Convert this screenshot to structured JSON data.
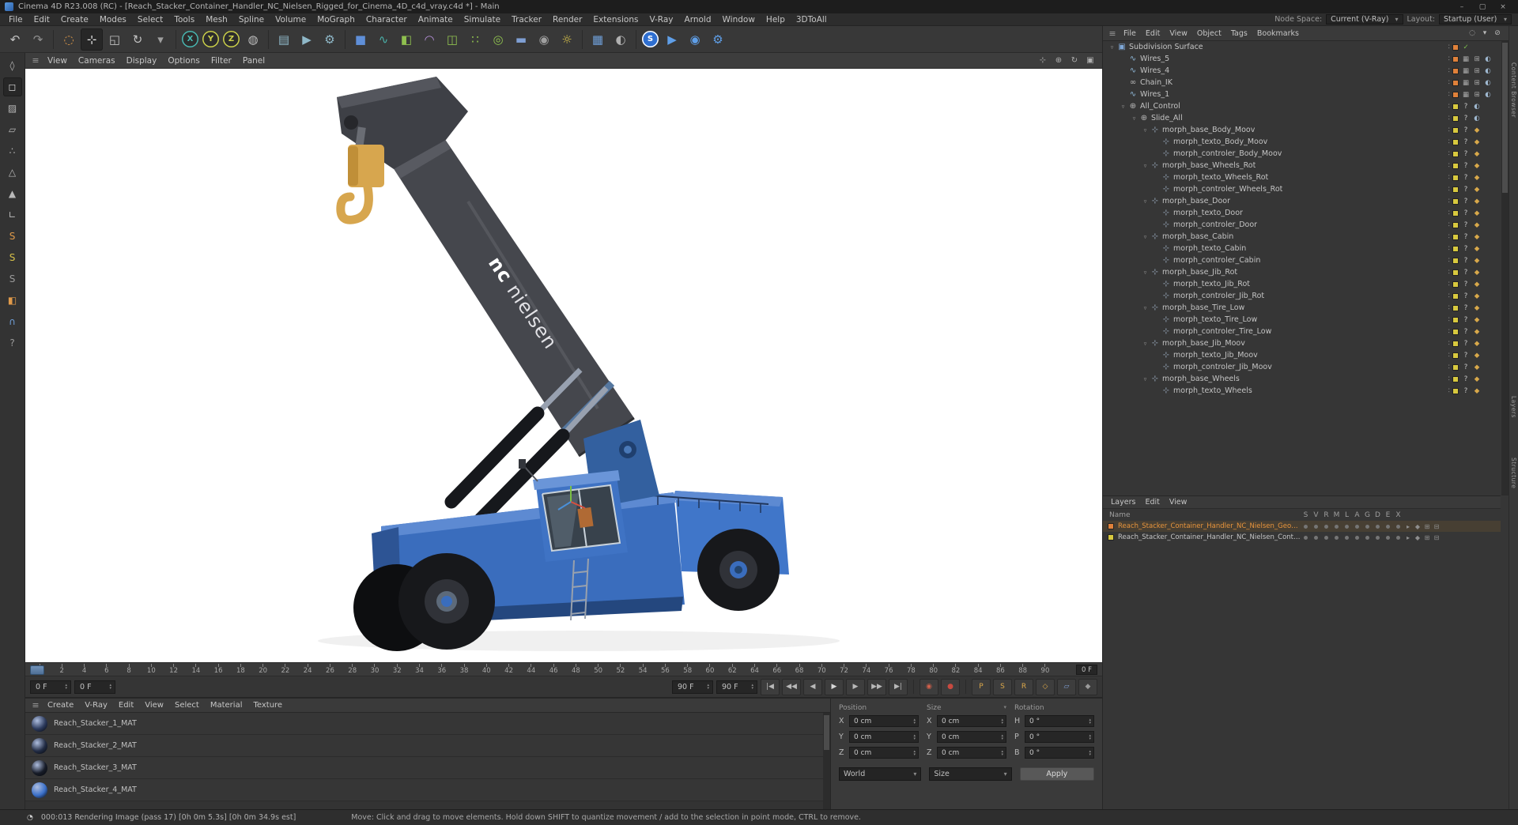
{
  "icons": {
    "hamburger": "≡"
  },
  "window": {
    "title": "Cinema 4D R23.008 (RC) - [Reach_Stacker_Container_Handler_NC_Nielsen_Rigged_for_Cinema_4D_c4d_vray.c4d *] - Main",
    "controls": {
      "minimize": "–",
      "maximize": "▢",
      "close": "×"
    }
  },
  "menu_bar": {
    "items": [
      "File",
      "Edit",
      "Create",
      "Modes",
      "Select",
      "Tools",
      "Mesh",
      "Spline",
      "Volume",
      "MoGraph",
      "Character",
      "Animate",
      "Simulate",
      "Tracker",
      "Render",
      "Extensions",
      "V-Ray",
      "Arnold",
      "Window",
      "Help",
      "3DToAll"
    ],
    "node_space": {
      "label": "Node Space:",
      "value": "Current (V-Ray)"
    },
    "layout": {
      "label": "Layout:",
      "value": "Startup (User)"
    }
  },
  "toolbar": {
    "icons": [
      {
        "name": "undo-icon",
        "glyph": "↶",
        "fg": "#c2c2c2"
      },
      {
        "name": "redo-icon",
        "glyph": "↷",
        "fg": "#8f8f8f"
      },
      {
        "divider": true
      },
      {
        "name": "live-selection-icon",
        "glyph": "◌",
        "fg": "#e09a4a"
      },
      {
        "name": "move-tool-icon",
        "glyph": "⊹",
        "fg": "#ececec",
        "active": true
      },
      {
        "name": "scale-tool-icon",
        "glyph": "◱",
        "fg": "#c2c2c2"
      },
      {
        "name": "rotate-tool-icon",
        "glyph": "↻",
        "fg": "#c2c2c2"
      },
      {
        "name": "last-used-tool-icon",
        "glyph": "▾",
        "fg": "#9f9f9f"
      },
      {
        "divider": true
      },
      {
        "name": "x-axis-lock-button",
        "glyph": "X",
        "fg": "#49b8b2",
        "shape": "circle"
      },
      {
        "name": "y-axis-lock-button",
        "glyph": "Y",
        "fg": "#cdd24a",
        "shape": "circle"
      },
      {
        "name": "z-axis-lock-button",
        "glyph": "Z",
        "fg": "#cdd24a",
        "shape": "circle"
      },
      {
        "name": "coordinate-system-icon",
        "glyph": "◍",
        "fg": "#bdbdbd"
      },
      {
        "divider": true
      },
      {
        "name": "render-view-icon",
        "glyph": "▤",
        "fg": "#8fb8c8"
      },
      {
        "name": "render-picture-viewer-icon",
        "glyph": "▶",
        "fg": "#8fb8c8"
      },
      {
        "name": "render-settings-icon",
        "glyph": "⚙",
        "fg": "#8fb8c8"
      },
      {
        "divider": true
      },
      {
        "name": "cube-primitive-icon",
        "glyph": "■",
        "fg": "#5f8fd8"
      },
      {
        "name": "spline-pen-icon",
        "glyph": "∿",
        "fg": "#4ab0a8"
      },
      {
        "name": "subdivision-surface-generator-icon",
        "glyph": "◧",
        "fg": "#8fc04f"
      },
      {
        "name": "bend-deformer-icon",
        "glyph": "◠",
        "fg": "#b58fd8"
      },
      {
        "name": "instance-icon",
        "glyph": "◫",
        "fg": "#8fc04f"
      },
      {
        "name": "cloner-icon",
        "glyph": "∷",
        "fg": "#8fc04f"
      },
      {
        "name": "field-icon",
        "glyph": "◎",
        "fg": "#8fc04f"
      },
      {
        "name": "floor-icon",
        "glyph": "▬",
        "fg": "#7f9fd4"
      },
      {
        "name": "camera-icon",
        "glyph": "◉",
        "fg": "#9f9f9f"
      },
      {
        "name": "light-icon",
        "glyph": "☼",
        "fg": "#d8c24a"
      },
      {
        "divider": true
      },
      {
        "name": "display-mode-icon",
        "glyph": "▦",
        "fg": "#6f9fd8"
      },
      {
        "name": "material-preview-icon",
        "glyph": "◐",
        "fg": "#b0b0b0"
      },
      {
        "divider": true
      },
      {
        "name": "vray-logo-icon",
        "glyph": "S",
        "fg": "#ffffff",
        "bg": "#2f6fd0",
        "shape": "circle"
      },
      {
        "name": "vray-render-icon",
        "glyph": "▶",
        "fg": "#5f9fe8"
      },
      {
        "name": "vray-ipr-icon",
        "glyph": "◉",
        "fg": "#5f9fe8"
      },
      {
        "name": "vray-settings-icon",
        "glyph": "⚙",
        "fg": "#5f9fe8"
      }
    ]
  },
  "left_toolbar": {
    "icons": [
      {
        "name": "make-editable-icon",
        "glyph": "◊",
        "fg": "#b8b8b8"
      },
      {
        "name": "model-mode-icon",
        "glyph": "◻",
        "fg": "#d8d8d8",
        "active": true
      },
      {
        "name": "texture-mode-icon",
        "glyph": "▨",
        "fg": "#b8b8b8"
      },
      {
        "name": "workplane-mode-icon",
        "glyph": "▱",
        "fg": "#b8b8b8"
      },
      {
        "name": "points-mode-icon",
        "glyph": "∴",
        "fg": "#b8b8b8"
      },
      {
        "name": "edges-mode-icon",
        "glyph": "△",
        "fg": "#b8b8b8"
      },
      {
        "name": "polygons-mode-icon",
        "glyph": "▲",
        "fg": "#b8b8b8"
      },
      {
        "name": "measure-icon",
        "glyph": "∟",
        "fg": "#b8b8b8"
      },
      {
        "name": "snap-scale-icon",
        "glyph": "S",
        "fg": "#e09a4a"
      },
      {
        "name": "snap-mode-icon",
        "glyph": "S",
        "fg": "#d8c24a"
      },
      {
        "name": "snap-state-icon",
        "glyph": "S",
        "fg": "#9a9a9a"
      },
      {
        "name": "paint-setup-icon",
        "glyph": "◧",
        "fg": "#e09a4a"
      },
      {
        "name": "magnet-snap-icon",
        "glyph": "∩",
        "fg": "#6f9fd8"
      },
      {
        "name": "help-icon",
        "glyph": "?",
        "fg": "#9a9a9a"
      }
    ]
  },
  "viewport": {
    "menus": [
      "View",
      "Cameras",
      "Display",
      "Options",
      "Filter",
      "Panel"
    ],
    "nav_icons": [
      {
        "name": "pan-view-icon",
        "glyph": "⊹"
      },
      {
        "name": "zoom-view-icon",
        "glyph": "⊕"
      },
      {
        "name": "rotate-view-icon",
        "glyph": "↻"
      },
      {
        "name": "toggle-view-icon",
        "glyph": "▣"
      }
    ],
    "watermark": {
      "bold": "nc",
      "rest": "nielsen"
    }
  },
  "object_manager": {
    "menus": [
      "File",
      "Edit",
      "View",
      "Object",
      "Tags",
      "Bookmarks"
    ],
    "menu_icons": [
      {
        "name": "om-search-icon",
        "glyph": "◌"
      },
      {
        "name": "om-filter-icon",
        "glyph": "▾"
      },
      {
        "name": "om-lock-icon",
        "glyph": "⊘"
      }
    ],
    "tree": [
      {
        "label": "Subdivision Surface",
        "depth": 0,
        "icon": "subdivision-surface",
        "caret": true,
        "dot": "#e0813a",
        "tags": [
          "check"
        ]
      },
      {
        "label": "Wires_5",
        "depth": 1,
        "icon": "spline",
        "dot": "#e0813a",
        "tags": [
          "display",
          "xpresso",
          "phong"
        ]
      },
      {
        "label": "Wires_4",
        "depth": 1,
        "icon": "spline",
        "dot": "#e0813a",
        "tags": [
          "display",
          "xpresso",
          "phong"
        ]
      },
      {
        "label": "Chain_IK",
        "depth": 1,
        "icon": "chain",
        "dot": "#e0813a",
        "tags": [
          "display",
          "xpresso",
          "phong"
        ]
      },
      {
        "label": "Wires_1",
        "depth": 1,
        "icon": "spline",
        "dot": "#e0813a",
        "tags": [
          "display",
          "xpresso",
          "phong"
        ]
      },
      {
        "label": "All_Control",
        "depth": 1,
        "icon": "null",
        "caret": true,
        "dot": "#d8c93e",
        "tags": [
          "question",
          "phong"
        ]
      },
      {
        "label": "Slide_All",
        "depth": 2,
        "icon": "null",
        "caret": true,
        "dot": "#d8c93e",
        "tags": [
          "question",
          "phong"
        ]
      },
      {
        "label": "morph_base_Body_Moov",
        "depth": 3,
        "icon": "morph",
        "caret": true,
        "dot": "#d8c93e",
        "tags": [
          "question",
          "key"
        ]
      },
      {
        "label": "morph_texto_Body_Moov",
        "depth": 4,
        "icon": "morph",
        "dot": "#d8c93e",
        "tags": [
          "question",
          "key"
        ]
      },
      {
        "label": "morph_controler_Body_Moov",
        "depth": 4,
        "icon": "morph",
        "dot": "#d8c93e",
        "tags": [
          "question",
          "key"
        ]
      },
      {
        "label": "morph_base_Wheels_Rot",
        "depth": 3,
        "icon": "morph",
        "caret": true,
        "dot": "#d8c93e",
        "tags": [
          "question",
          "key"
        ]
      },
      {
        "label": "morph_texto_Wheels_Rot",
        "depth": 4,
        "icon": "morph",
        "dot": "#d8c93e",
        "tags": [
          "question",
          "key"
        ]
      },
      {
        "label": "morph_controler_Wheels_Rot",
        "depth": 4,
        "icon": "morph",
        "dot": "#d8c93e",
        "tags": [
          "question",
          "key"
        ]
      },
      {
        "label": "morph_base_Door",
        "depth": 3,
        "icon": "morph",
        "caret": true,
        "dot": "#d8c93e",
        "tags": [
          "question",
          "key"
        ]
      },
      {
        "label": "morph_texto_Door",
        "depth": 4,
        "icon": "morph",
        "dot": "#d8c93e",
        "tags": [
          "question",
          "key"
        ]
      },
      {
        "label": "morph_controler_Door",
        "depth": 4,
        "icon": "morph",
        "dot": "#d8c93e",
        "tags": [
          "question",
          "key"
        ]
      },
      {
        "label": "morph_base_Cabin",
        "depth": 3,
        "icon": "morph",
        "caret": true,
        "dot": "#d8c93e",
        "tags": [
          "question",
          "key"
        ]
      },
      {
        "label": "morph_texto_Cabin",
        "depth": 4,
        "icon": "morph",
        "dot": "#d8c93e",
        "tags": [
          "question",
          "key"
        ]
      },
      {
        "label": "morph_controler_Cabin",
        "depth": 4,
        "icon": "morph",
        "dot": "#d8c93e",
        "tags": [
          "question",
          "key"
        ]
      },
      {
        "label": "morph_base_Jib_Rot",
        "depth": 3,
        "icon": "morph",
        "caret": true,
        "dot": "#d8c93e",
        "tags": [
          "question",
          "key"
        ]
      },
      {
        "label": "morph_texto_Jib_Rot",
        "depth": 4,
        "icon": "morph",
        "dot": "#d8c93e",
        "tags": [
          "question",
          "key"
        ]
      },
      {
        "label": "morph_controler_Jib_Rot",
        "depth": 4,
        "icon": "morph",
        "dot": "#d8c93e",
        "tags": [
          "question",
          "key"
        ]
      },
      {
        "label": "morph_base_Tire_Low",
        "depth": 3,
        "icon": "morph",
        "caret": true,
        "dot": "#d8c93e",
        "tags": [
          "question",
          "key"
        ]
      },
      {
        "label": "morph_texto_Tire_Low",
        "depth": 4,
        "icon": "morph",
        "dot": "#d8c93e",
        "tags": [
          "question",
          "key"
        ]
      },
      {
        "label": "morph_controler_Tire_Low",
        "depth": 4,
        "icon": "morph",
        "dot": "#d8c93e",
        "tags": [
          "question",
          "key"
        ]
      },
      {
        "label": "morph_base_Jib_Moov",
        "depth": 3,
        "icon": "morph",
        "caret": true,
        "dot": "#d8c93e",
        "tags": [
          "question",
          "key"
        ]
      },
      {
        "label": "morph_texto_Jib_Moov",
        "depth": 4,
        "icon": "morph",
        "dot": "#d8c93e",
        "tags": [
          "question",
          "key"
        ]
      },
      {
        "label": "morph_controler_Jib_Moov",
        "depth": 4,
        "icon": "morph",
        "dot": "#d8c93e",
        "tags": [
          "question",
          "key"
        ]
      },
      {
        "label": "morph_base_Wheels",
        "depth": 3,
        "icon": "morph",
        "caret": true,
        "dot": "#d8c93e",
        "tags": [
          "question",
          "key"
        ]
      },
      {
        "label": "morph_texto_Wheels",
        "depth": 4,
        "icon": "morph",
        "dot": "#d8c93e",
        "tags": [
          "question",
          "key"
        ]
      }
    ]
  },
  "layer_manager": {
    "menus": [
      "Layers",
      "Edit",
      "View"
    ],
    "name_header": "Name",
    "columns": [
      "S",
      "V",
      "R",
      "M",
      "L",
      "A",
      "G",
      "D",
      "E",
      "X"
    ],
    "row_icons": [
      {
        "name": "animation-play-icon",
        "glyph": "▸"
      },
      {
        "name": "keyframe-icon",
        "glyph": "◆"
      },
      {
        "name": "generators-icon",
        "glyph": "⊞"
      },
      {
        "name": "expressions-icon",
        "glyph": "⊟"
      }
    ],
    "rows": [
      {
        "name": "Reach_Stacker_Container_Handler_NC_Nielsen_Geometry",
        "color": "#e0813a",
        "selected": true
      },
      {
        "name": "Reach_Stacker_Container_Handler_NC_Nielsen_Controllers",
        "color": "#d8c93e",
        "selected": false
      }
    ]
  },
  "timeline": {
    "ticks": [
      0,
      2,
      4,
      6,
      8,
      10,
      12,
      14,
      16,
      18,
      20,
      22,
      24,
      26,
      28,
      30,
      32,
      34,
      36,
      38,
      40,
      42,
      44,
      46,
      48,
      50,
      52,
      54,
      56,
      58,
      60,
      62,
      64,
      66,
      68,
      70,
      72,
      74,
      76,
      78,
      80,
      82,
      84,
      86,
      88,
      90
    ],
    "current_frame_label": "0 F"
  },
  "transport": {
    "current_frame": "0 F",
    "start_frame": "0 F",
    "end_frame": "90 F",
    "max_frame": "90 F",
    "buttons": [
      {
        "name": "go-to-start-button",
        "glyph": "|◀"
      },
      {
        "name": "previous-key-button",
        "glyph": "◀◀"
      },
      {
        "name": "previous-frame-button",
        "glyph": "◀"
      },
      {
        "name": "play-button",
        "glyph": "▶",
        "fg": "#d8d8d8"
      },
      {
        "name": "next-frame-button",
        "glyph": "▶"
      },
      {
        "name": "next-key-button",
        "glyph": "▶▶"
      },
      {
        "name": "go-to-end-button",
        "glyph": "▶|"
      },
      {
        "divider": true
      },
      {
        "name": "record-keyframe-icon",
        "glyph": "◉",
        "fg": "#cf5f4a"
      },
      {
        "name": "autokeying-icon",
        "glyph": "●",
        "fg": "#c84a40"
      },
      {
        "divider": true
      },
      {
        "name": "record-position-toggle",
        "glyph": "P",
        "fg": "#dca84a"
      },
      {
        "name": "record-scale-toggle",
        "glyph": "S",
        "fg": "#dca84a"
      },
      {
        "name": "record-rotation-toggle",
        "glyph": "R",
        "fg": "#dca84a"
      },
      {
        "name": "record-parameter-toggle",
        "glyph": "◇",
        "fg": "#dca84a"
      },
      {
        "name": "record-pla-toggle",
        "glyph": "▱",
        "fg": "#7f9fd4"
      },
      {
        "name": "keyframe-selection-icon",
        "glyph": "◆",
        "fg": "#9a9a9a"
      }
    ]
  },
  "materials": {
    "menus": [
      "Create",
      "V-Ray",
      "Edit",
      "View",
      "Select",
      "Material",
      "Texture"
    ],
    "items": [
      {
        "label": "Reach_Stacker_1_MAT",
        "thumb": "#2c3a5c"
      },
      {
        "label": "Reach_Stacker_2_MAT",
        "thumb": "#222c44"
      },
      {
        "label": "Reach_Stacker_3_MAT",
        "thumb": "#171c28"
      },
      {
        "label": "Reach_Stacker_4_MAT",
        "thumb": "#3a6fc8"
      }
    ]
  },
  "coordinate_manager": {
    "columns": [
      {
        "header": "Position",
        "fields": [
          {
            "label": "X",
            "value": "0 cm"
          },
          {
            "label": "Y",
            "value": "0 cm"
          },
          {
            "label": "Z",
            "value": "0 cm"
          }
        ]
      },
      {
        "header": "Size",
        "dropdown": true,
        "fields": [
          {
            "label": "X",
            "value": "0 cm"
          },
          {
            "label": "Y",
            "value": "0 cm"
          },
          {
            "label": "Z",
            "value": "0 cm"
          }
        ]
      },
      {
        "header": "Rotation",
        "fields": [
          {
            "label": "H",
            "value": "0 °"
          },
          {
            "label": "P",
            "value": "0 °"
          },
          {
            "label": "B",
            "value": "0 °"
          }
        ]
      }
    ],
    "system_dropdown": "World",
    "mode_dropdown": "Size",
    "apply_button": "Apply"
  },
  "status_bar": {
    "render_text": "000:013 Rendering Image (pass 17) [0h 0m 5.3s] [0h 0m 34.9s est]",
    "hint_text": "Move: Click and drag to move elements. Hold down SHIFT to quantize movement / add to the selection in point mode, CTRL to remove."
  },
  "right_edge": {
    "tabs": [
      "Content Browser",
      "Layers",
      "Structure"
    ]
  }
}
